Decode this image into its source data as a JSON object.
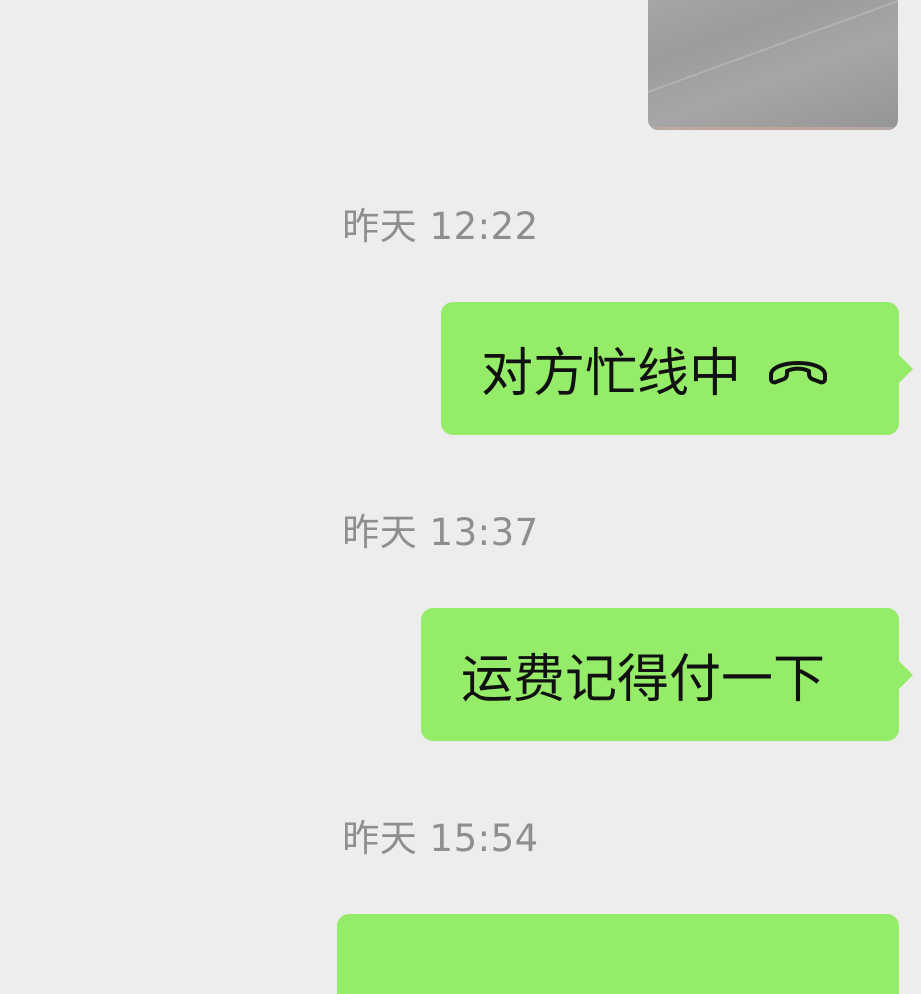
{
  "chat": {
    "messages": [
      {
        "kind": "image",
        "sender": "me"
      },
      {
        "kind": "timestamp",
        "text": "昨天 12:22"
      },
      {
        "kind": "call",
        "sender": "me",
        "text": "对方忙线中",
        "icon": "phone-hangup-icon"
      },
      {
        "kind": "timestamp",
        "text": "昨天 13:37"
      },
      {
        "kind": "text",
        "sender": "me",
        "text": "运费记得付一下"
      },
      {
        "kind": "timestamp",
        "text": "昨天 15:54"
      },
      {
        "kind": "text",
        "sender": "me",
        "text": ""
      }
    ]
  },
  "colors": {
    "background": "#ededed",
    "bubble_sent": "#95ec69",
    "timestamp": "#8e8e8e",
    "message_text": "#111111"
  }
}
